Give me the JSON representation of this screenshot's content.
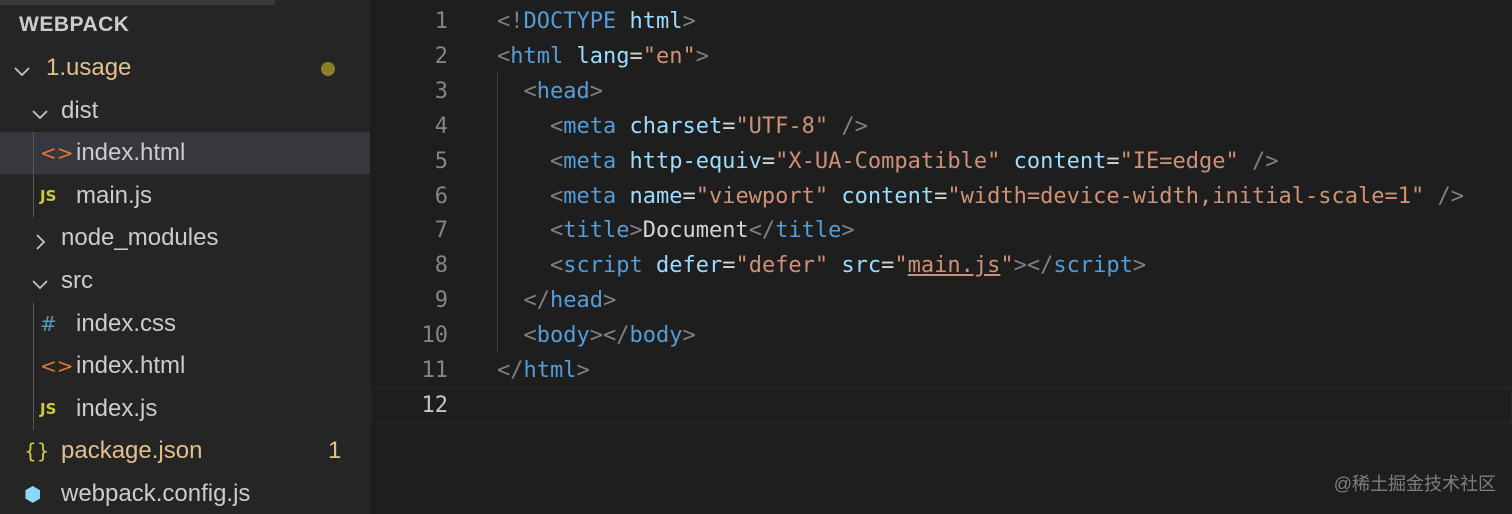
{
  "explorer": {
    "header": "WEBPACK",
    "items": [
      {
        "depth": 0,
        "kind": "folder",
        "expanded": true,
        "label": "1.usage",
        "color": "#e2c08d",
        "decoration": "dot",
        "decoration_color": "#8d7f2a",
        "icon": "chevron-down-icon",
        "selected": false
      },
      {
        "depth": 1,
        "kind": "folder",
        "expanded": true,
        "label": "dist",
        "color": "#cccccc",
        "icon": "chevron-down-icon",
        "selected": false
      },
      {
        "depth": 2,
        "kind": "file",
        "label": "index.html",
        "color": "#cccccc",
        "icon": "html-file-icon",
        "glyph": "<>",
        "glyph_color": "#e37933",
        "selected": true
      },
      {
        "depth": 2,
        "kind": "file",
        "label": "main.js",
        "color": "#cccccc",
        "icon": "js-file-icon",
        "glyph": "JS",
        "glyph_color": "#cbcb41",
        "selected": false
      },
      {
        "depth": 1,
        "kind": "folder",
        "expanded": false,
        "label": "node_modules",
        "color": "#cccccc",
        "icon": "chevron-right-icon",
        "selected": false
      },
      {
        "depth": 1,
        "kind": "folder",
        "expanded": true,
        "label": "src",
        "color": "#cccccc",
        "icon": "chevron-down-icon",
        "selected": false
      },
      {
        "depth": 2,
        "kind": "file",
        "label": "index.css",
        "color": "#cccccc",
        "icon": "css-file-icon",
        "glyph": "#",
        "glyph_color": "#519aba",
        "selected": false
      },
      {
        "depth": 2,
        "kind": "file",
        "label": "index.html",
        "color": "#cccccc",
        "icon": "html-file-icon",
        "glyph": "<>",
        "glyph_color": "#e37933",
        "selected": false
      },
      {
        "depth": 2,
        "kind": "file",
        "label": "index.js",
        "color": "#cccccc",
        "icon": "js-file-icon",
        "glyph": "JS",
        "glyph_color": "#cbcb41",
        "selected": false
      },
      {
        "depth": 1,
        "kind": "file",
        "label": "package.json",
        "color": "#e2c08d",
        "icon": "json-file-icon",
        "glyph": "{}",
        "glyph_color": "#cbcb41",
        "badge": "1",
        "badge_color": "#e2c08d",
        "selected": false
      },
      {
        "depth": 1,
        "kind": "file",
        "label": "webpack.config.js",
        "color": "#cccccc",
        "icon": "webpack-icon",
        "glyph": "⬢",
        "glyph_color": "#8ed6fb",
        "selected": false
      }
    ]
  },
  "editor": {
    "current_line": 12,
    "lines": [
      {
        "n": "1",
        "tokens": [
          {
            "t": "<!",
            "c": "#808080"
          },
          {
            "t": "DOCTYPE",
            "c": "#569cd6"
          },
          {
            "t": " ",
            "c": "#d4d4d4"
          },
          {
            "t": "html",
            "c": "#9cdcfe"
          },
          {
            "t": ">",
            "c": "#808080"
          }
        ]
      },
      {
        "n": "2",
        "tokens": [
          {
            "t": "<",
            "c": "#808080"
          },
          {
            "t": "html",
            "c": "#569cd6"
          },
          {
            "t": " ",
            "c": "#d4d4d4"
          },
          {
            "t": "lang",
            "c": "#9cdcfe"
          },
          {
            "t": "=",
            "c": "#d4d4d4"
          },
          {
            "t": "\"en\"",
            "c": "#ce9178"
          },
          {
            "t": ">",
            "c": "#808080"
          }
        ]
      },
      {
        "n": "3",
        "tokens": [
          {
            "t": "  ",
            "c": "#d4d4d4"
          },
          {
            "t": "<",
            "c": "#808080"
          },
          {
            "t": "head",
            "c": "#569cd6"
          },
          {
            "t": ">",
            "c": "#808080"
          }
        ]
      },
      {
        "n": "4",
        "tokens": [
          {
            "t": "    ",
            "c": "#d4d4d4"
          },
          {
            "t": "<",
            "c": "#808080"
          },
          {
            "t": "meta",
            "c": "#569cd6"
          },
          {
            "t": " ",
            "c": "#d4d4d4"
          },
          {
            "t": "charset",
            "c": "#9cdcfe"
          },
          {
            "t": "=",
            "c": "#d4d4d4"
          },
          {
            "t": "\"UTF-8\"",
            "c": "#ce9178"
          },
          {
            "t": " />",
            "c": "#808080"
          }
        ]
      },
      {
        "n": "5",
        "tokens": [
          {
            "t": "    ",
            "c": "#d4d4d4"
          },
          {
            "t": "<",
            "c": "#808080"
          },
          {
            "t": "meta",
            "c": "#569cd6"
          },
          {
            "t": " ",
            "c": "#d4d4d4"
          },
          {
            "t": "http-equiv",
            "c": "#9cdcfe"
          },
          {
            "t": "=",
            "c": "#d4d4d4"
          },
          {
            "t": "\"X-UA-Compatible\"",
            "c": "#ce9178"
          },
          {
            "t": " ",
            "c": "#d4d4d4"
          },
          {
            "t": "content",
            "c": "#9cdcfe"
          },
          {
            "t": "=",
            "c": "#d4d4d4"
          },
          {
            "t": "\"IE=edge\"",
            "c": "#ce9178"
          },
          {
            "t": " />",
            "c": "#808080"
          }
        ]
      },
      {
        "n": "6",
        "tokens": [
          {
            "t": "    ",
            "c": "#d4d4d4"
          },
          {
            "t": "<",
            "c": "#808080"
          },
          {
            "t": "meta",
            "c": "#569cd6"
          },
          {
            "t": " ",
            "c": "#d4d4d4"
          },
          {
            "t": "name",
            "c": "#9cdcfe"
          },
          {
            "t": "=",
            "c": "#d4d4d4"
          },
          {
            "t": "\"viewport\"",
            "c": "#ce9178"
          },
          {
            "t": " ",
            "c": "#d4d4d4"
          },
          {
            "t": "content",
            "c": "#9cdcfe"
          },
          {
            "t": "=",
            "c": "#d4d4d4"
          },
          {
            "t": "\"width=device-width,initial-scale=1\"",
            "c": "#ce9178"
          },
          {
            "t": " />",
            "c": "#808080"
          }
        ]
      },
      {
        "n": "7",
        "tokens": [
          {
            "t": "    ",
            "c": "#d4d4d4"
          },
          {
            "t": "<",
            "c": "#808080"
          },
          {
            "t": "title",
            "c": "#569cd6"
          },
          {
            "t": ">",
            "c": "#808080"
          },
          {
            "t": "Document",
            "c": "#d4d4d4"
          },
          {
            "t": "</",
            "c": "#808080"
          },
          {
            "t": "title",
            "c": "#569cd6"
          },
          {
            "t": ">",
            "c": "#808080"
          }
        ]
      },
      {
        "n": "8",
        "tokens": [
          {
            "t": "    ",
            "c": "#d4d4d4"
          },
          {
            "t": "<",
            "c": "#808080"
          },
          {
            "t": "script",
            "c": "#569cd6"
          },
          {
            "t": " ",
            "c": "#d4d4d4"
          },
          {
            "t": "defer",
            "c": "#9cdcfe"
          },
          {
            "t": "=",
            "c": "#d4d4d4"
          },
          {
            "t": "\"defer\"",
            "c": "#ce9178"
          },
          {
            "t": " ",
            "c": "#d4d4d4"
          },
          {
            "t": "src",
            "c": "#9cdcfe"
          },
          {
            "t": "=",
            "c": "#d4d4d4"
          },
          {
            "t": "\"",
            "c": "#ce9178"
          },
          {
            "t": "main.js",
            "c": "#ce9178",
            "link": true
          },
          {
            "t": "\"",
            "c": "#ce9178"
          },
          {
            "t": "></",
            "c": "#808080"
          },
          {
            "t": "script",
            "c": "#569cd6"
          },
          {
            "t": ">",
            "c": "#808080"
          }
        ]
      },
      {
        "n": "9",
        "tokens": [
          {
            "t": "  ",
            "c": "#d4d4d4"
          },
          {
            "t": "</",
            "c": "#808080"
          },
          {
            "t": "head",
            "c": "#569cd6"
          },
          {
            "t": ">",
            "c": "#808080"
          }
        ]
      },
      {
        "n": "10",
        "tokens": [
          {
            "t": "  ",
            "c": "#d4d4d4"
          },
          {
            "t": "<",
            "c": "#808080"
          },
          {
            "t": "body",
            "c": "#569cd6"
          },
          {
            "t": "></",
            "c": "#808080"
          },
          {
            "t": "body",
            "c": "#569cd6"
          },
          {
            "t": ">",
            "c": "#808080"
          }
        ]
      },
      {
        "n": "11",
        "tokens": [
          {
            "t": "</",
            "c": "#808080"
          },
          {
            "t": "html",
            "c": "#569cd6"
          },
          {
            "t": ">",
            "c": "#808080"
          }
        ]
      },
      {
        "n": "12",
        "tokens": []
      }
    ]
  },
  "watermark": "@稀土掘金技术社区",
  "colors": {
    "line_number": "#858585",
    "line_number_active": "#c6c6c6",
    "selection": "#37373d"
  }
}
